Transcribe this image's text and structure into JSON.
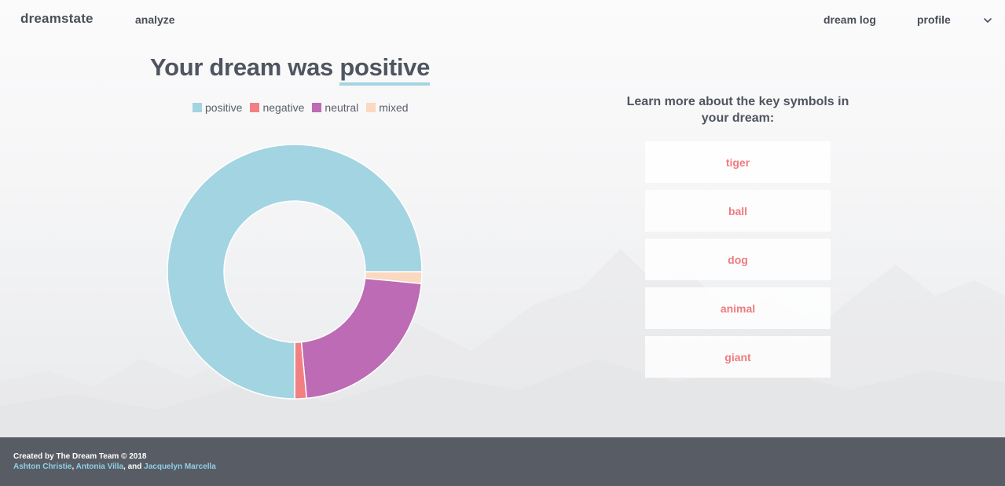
{
  "nav": {
    "brand": "dreamstate",
    "analyze": "analyze",
    "dream_log": "dream log",
    "profile": "profile"
  },
  "headline": {
    "prefix": "Your dream was",
    "sentiment": "positive",
    "underline_color": "#a3d4e2"
  },
  "chart_data": {
    "type": "pie",
    "style": "doughnut",
    "categories": [
      "positive",
      "negative",
      "neutral",
      "mixed"
    ],
    "values": [
      75.0,
      1.5,
      22.0,
      1.5
    ],
    "colors": [
      "#a3d4e2",
      "#f28083",
      "#bd6bb4",
      "#fad9c0"
    ],
    "legend": "top"
  },
  "symbols": {
    "title": "Learn more about the key symbols in your dream:",
    "items": [
      "tiger",
      "ball",
      "dog",
      "animal",
      "giant"
    ]
  },
  "footer": {
    "credit": "Created by The Dream Team © 2018",
    "authors": [
      "Ashton Christie",
      "Antonia Villa",
      "Jacquelyn Marcella"
    ],
    "sep1": ", ",
    "sep2": ", and "
  }
}
